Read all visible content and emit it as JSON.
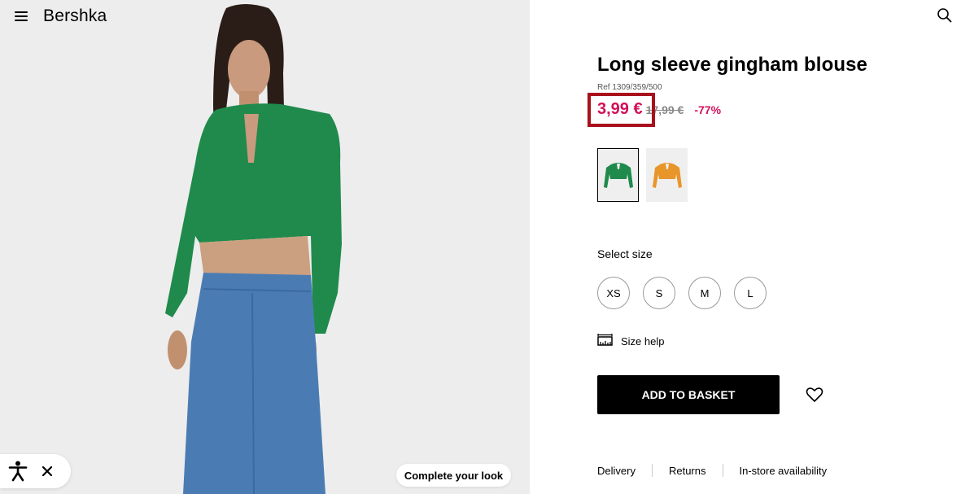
{
  "header": {
    "logo": "Bershka"
  },
  "product": {
    "title": "Long sleeve gingham blouse",
    "ref": "Ref 1309/359/500",
    "price_current": "3,99 €",
    "price_original": "17,99 €",
    "discount": "-77%"
  },
  "colors": [
    {
      "name": "green",
      "hex": "#1f8a4c",
      "selected": true
    },
    {
      "name": "orange",
      "hex": "#e8952a",
      "selected": false
    }
  ],
  "sizes": {
    "label": "Select size",
    "options": [
      "XS",
      "S",
      "M",
      "L"
    ]
  },
  "size_help": {
    "label": "Size help",
    "icon": "ruler-icon"
  },
  "actions": {
    "add_to_basket": "ADD TO BASKET",
    "wishlist_icon": "heart-icon"
  },
  "image_panel": {
    "complete_look": "Complete your look"
  },
  "info_links": [
    "Delivery",
    "Returns",
    "In-store availability"
  ],
  "theme": {
    "accent": "#d1105a",
    "highlight": "#a8101c"
  }
}
